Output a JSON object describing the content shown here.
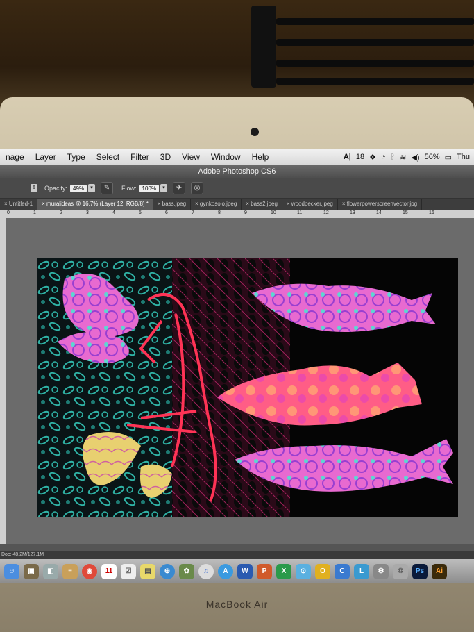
{
  "menubar": {
    "items": [
      "nage",
      "Layer",
      "Type",
      "Select",
      "Filter",
      "3D",
      "View",
      "Window",
      "Help"
    ],
    "right": {
      "adobe_badge": "18",
      "battery": "56%",
      "day": "Thu"
    }
  },
  "titlebar": {
    "title": "Adobe Photoshop CS6"
  },
  "options": {
    "opacity_label": "Opacity:",
    "opacity_value": "49%",
    "flow_label": "Flow:",
    "flow_value": "100%"
  },
  "tabs": [
    {
      "label": "× Untitled-1"
    },
    {
      "label": "× muralideas @ 16.7% (Layer 12, RGB/8) *"
    },
    {
      "label": "× bass.jpeg"
    },
    {
      "label": "× gynkosolo.jpeg"
    },
    {
      "label": "× bass2.jpeg"
    },
    {
      "label": "× woodpecker.jpeg"
    },
    {
      "label": "× flowerpowerscreenvector.jpg"
    }
  ],
  "ruler": {
    "ticks": [
      "0",
      "1",
      "2",
      "3",
      "4",
      "5",
      "6",
      "7",
      "8",
      "9",
      "10",
      "11",
      "12",
      "13",
      "14",
      "15",
      "16"
    ]
  },
  "status": {
    "doc": "Doc: 48.2M/127.1M"
  },
  "dock": {
    "apps": [
      "finder",
      "photos",
      "preview",
      "notes",
      "chrome",
      "calendar",
      "reminders",
      "stickies",
      "safari",
      "iphoto",
      "itunes",
      "appstore",
      "office-word",
      "office-powerpoint",
      "office-excel",
      "finder2",
      "outlook",
      "onenote",
      "lync",
      "systemprefs",
      "trash",
      "photoshop",
      "illustrator"
    ],
    "calendar_day": "11",
    "ps_label": "Ps",
    "ai_label": "Ai"
  },
  "laptop": {
    "brand": "MacBook Air"
  },
  "colors": {
    "teal": "#2fb3a6",
    "pink": "#e85bb5",
    "magenta": "#c040d0",
    "coral": "#ff5577",
    "red_outline": "#ff3355"
  }
}
